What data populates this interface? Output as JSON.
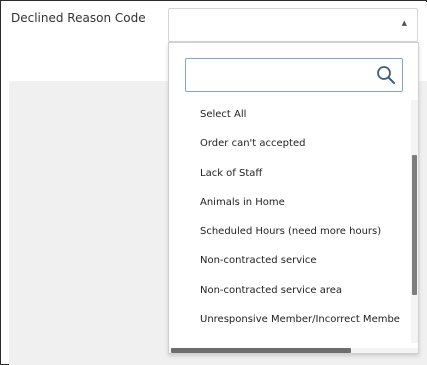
{
  "field": {
    "label": "Declined Reason Code",
    "value": ""
  },
  "dropdown": {
    "search_value": "",
    "search_placeholder": "",
    "options": [
      "Select All",
      "Order can't accepted",
      "Lack of Staff",
      "Animals in Home",
      "Scheduled Hours (need more hours)",
      "Non-contracted service",
      "Non-contracted service area",
      "Unresponsive Member/Incorrect Membe"
    ]
  },
  "icons": {
    "caret": "caret-up-icon",
    "search": "search-icon"
  },
  "colors": {
    "border": "#d5d5d5",
    "search_border": "#7fa7c9",
    "background_gray": "#f0f0f0",
    "text": "#222222"
  }
}
